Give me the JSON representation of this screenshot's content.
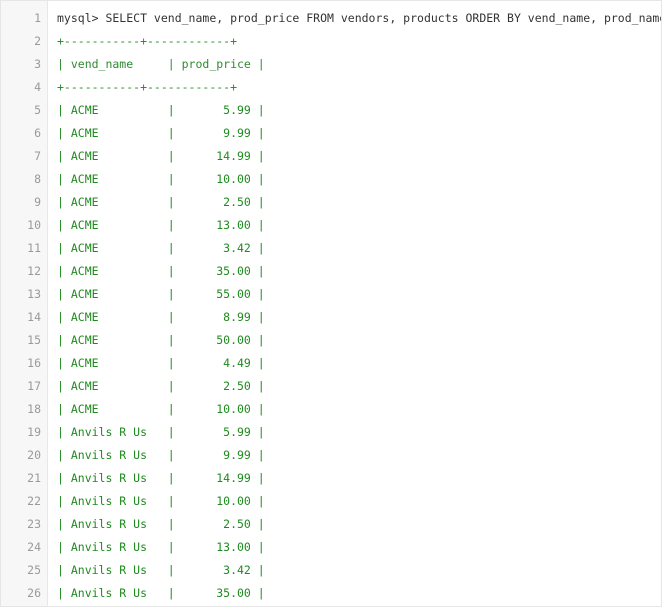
{
  "editor": {
    "lines": [
      {
        "num": "1",
        "text": "mysql> SELECT vend_name, prod_price FROM vendors, products ORDER BY vend_name, prod_name;",
        "kind": "cmd"
      },
      {
        "num": "2",
        "text": "+-----------+------------+",
        "kind": "border"
      },
      {
        "num": "3",
        "text": "| vend_name     | prod_price |",
        "kind": "border"
      },
      {
        "num": "4",
        "text": "+-----------+------------+",
        "kind": "border"
      },
      {
        "num": "5",
        "text": "| ACME          |       5.99 |",
        "kind": "row"
      },
      {
        "num": "6",
        "text": "| ACME          |       9.99 |",
        "kind": "row"
      },
      {
        "num": "7",
        "text": "| ACME          |      14.99 |",
        "kind": "row"
      },
      {
        "num": "8",
        "text": "| ACME          |      10.00 |",
        "kind": "row"
      },
      {
        "num": "9",
        "text": "| ACME          |       2.50 |",
        "kind": "row"
      },
      {
        "num": "10",
        "text": "| ACME          |      13.00 |",
        "kind": "row"
      },
      {
        "num": "11",
        "text": "| ACME          |       3.42 |",
        "kind": "row"
      },
      {
        "num": "12",
        "text": "| ACME          |      35.00 |",
        "kind": "row"
      },
      {
        "num": "13",
        "text": "| ACME          |      55.00 |",
        "kind": "row"
      },
      {
        "num": "14",
        "text": "| ACME          |       8.99 |",
        "kind": "row"
      },
      {
        "num": "15",
        "text": "| ACME          |      50.00 |",
        "kind": "row"
      },
      {
        "num": "16",
        "text": "| ACME          |       4.49 |",
        "kind": "row"
      },
      {
        "num": "17",
        "text": "| ACME          |       2.50 |",
        "kind": "row"
      },
      {
        "num": "18",
        "text": "| ACME          |      10.00 |",
        "kind": "row"
      },
      {
        "num": "19",
        "text": "| Anvils R Us   |       5.99 |",
        "kind": "row"
      },
      {
        "num": "20",
        "text": "| Anvils R Us   |       9.99 |",
        "kind": "row"
      },
      {
        "num": "21",
        "text": "| Anvils R Us   |      14.99 |",
        "kind": "row"
      },
      {
        "num": "22",
        "text": "| Anvils R Us   |      10.00 |",
        "kind": "row"
      },
      {
        "num": "23",
        "text": "| Anvils R Us   |       2.50 |",
        "kind": "row"
      },
      {
        "num": "24",
        "text": "| Anvils R Us   |      13.00 |",
        "kind": "row"
      },
      {
        "num": "25",
        "text": "| Anvils R Us   |       3.42 |",
        "kind": "row"
      },
      {
        "num": "26",
        "text": "| Anvils R Us   |      35.00 |",
        "kind": "row"
      }
    ]
  },
  "colors": {
    "gutter_bg": "#f7f7f7",
    "line_number": "#9a9a9a",
    "command_text": "#333333",
    "table_text": "#1f8a1f"
  }
}
